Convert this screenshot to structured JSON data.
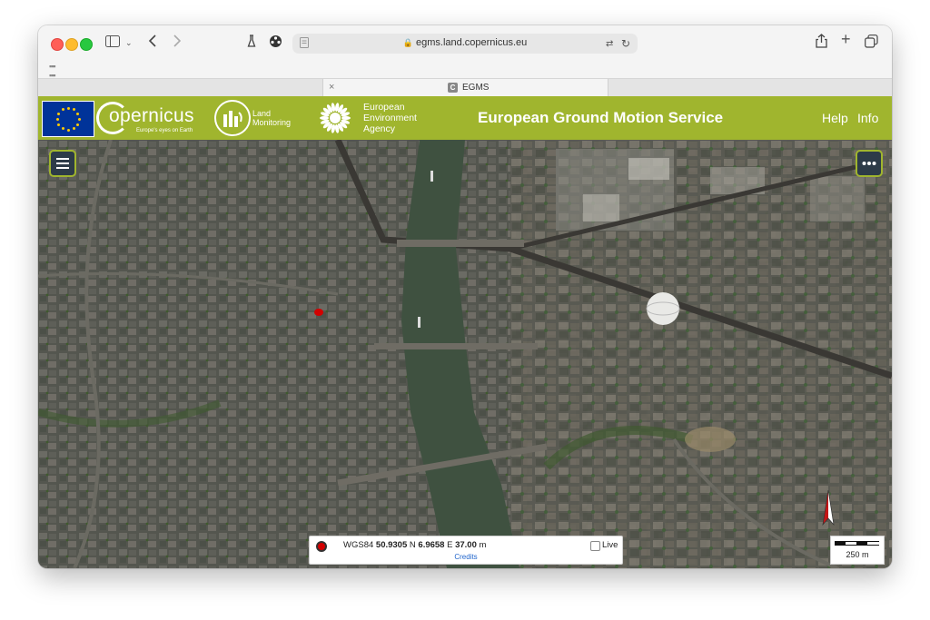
{
  "browser": {
    "url": "egms.land.copernicus.eu",
    "tab_title": "EGMS",
    "tab_close": "×",
    "tab_favicon": "C"
  },
  "header": {
    "copernicus_text": "opernicus",
    "copernicus_tagline": "Europe's eyes on Earth",
    "land_monitoring": [
      "Land",
      "Monitoring"
    ],
    "eea": [
      "European",
      "Environment",
      "Agency"
    ],
    "title": "European Ground Motion Service",
    "help": "Help",
    "info": "Info"
  },
  "map": {
    "menu_icon": "hamburger-menu-icon",
    "more_icon": "more-dots-icon",
    "coords": {
      "crs": "WGS84",
      "lat": "50.9305",
      "lat_dir": "N",
      "lon": "6.9658",
      "lon_dir": "E",
      "elev": "37.00",
      "elev_unit": "m",
      "live_label": "Live",
      "credits": "Credits"
    },
    "scale": "250 m"
  },
  "colors": {
    "header_green": "#a0b52e",
    "button_dark": "#2d3b48",
    "river": "#3f5140",
    "marker_red": "#d20000"
  }
}
